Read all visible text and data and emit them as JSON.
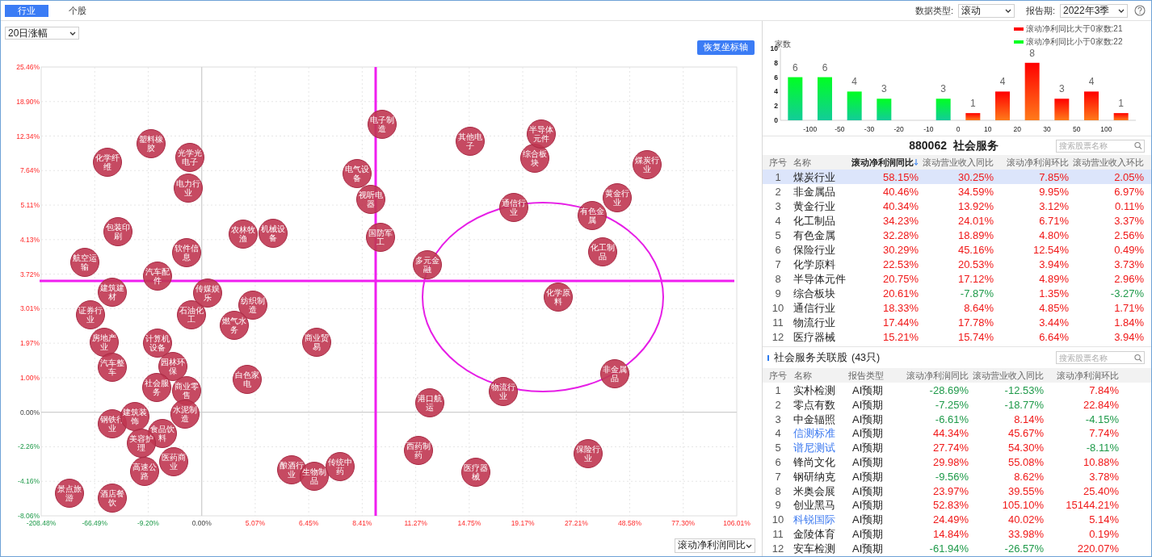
{
  "tabs": [
    {
      "label": "行业",
      "selected": true
    },
    {
      "label": "个股",
      "selected": false
    }
  ],
  "filters": [
    {
      "label": "数据类型:",
      "value": "滚动"
    },
    {
      "label": "报告期:",
      "value": "2022年3季"
    }
  ],
  "scatter_panel": {
    "period_select": "20日涨幅",
    "reset_button": "恢复坐标轴",
    "x_metric_select": "滚动净利润同比",
    "y_axis_labels": [
      "25.46%",
      "18.90%",
      "12.34%",
      "7.64%",
      "5.11%",
      "4.13%",
      "3.72%",
      "3.01%",
      "1.97%",
      "1.00%",
      "0.00%",
      "-2.26%",
      "-4.16%",
      "-8.06%"
    ],
    "x_axis_labels": [
      "-208.48%",
      "-66.49%",
      "-9.20%",
      "0.00%",
      "5.07%",
      "6.45%",
      "8.41%",
      "11.27%",
      "14.75%",
      "19.17%",
      "27.21%",
      "48.58%",
      "77.30%",
      "106.01%"
    ],
    "bubbles": [
      "化学纤维",
      "塑料橡胶",
      "光学光电子",
      "电力行业",
      "包装印刷",
      "航空运输",
      "软件信息",
      "汽车配件",
      "农林牧渔",
      "机械设备",
      "电子制造",
      "电气设备",
      "视听电器",
      "国防军工",
      "证券行业",
      "建筑建材",
      "石油化工",
      "传媒娱乐",
      "纺织制造",
      "燃气水务",
      "房地产业",
      "计算机设备",
      "商业贸易",
      "汽车整车",
      "园林环保",
      "社会服务",
      "商业零售",
      "白色家电",
      "钢铁行业",
      "建筑装饰",
      "食品饮料",
      "水泥制造",
      "美容护理",
      "医药商业",
      "高速公路",
      "景点旅游",
      "酒店餐饮",
      "酿酒行业",
      "生物制品",
      "传统中药",
      "其他电子",
      "综合板块",
      "半导体元件",
      "煤炭行业",
      "通信行业",
      "有色金属",
      "黄金行业",
      "化工制品",
      "多元金融",
      "化学原料",
      "非金属品",
      "物流行业",
      "港口航运",
      "西药制药",
      "医疗器械",
      "保险行业"
    ]
  },
  "distribution": {
    "chart_data": {
      "type": "bar",
      "ylabel": "家数",
      "categories": [
        null,
        null,
        null,
        null,
        null,
        null,
        null,
        null,
        null,
        null,
        null,
        null
      ],
      "yticks": [
        0,
        2,
        4,
        6,
        8,
        10
      ],
      "ylim": [
        0,
        10
      ],
      "data_labels": true,
      "legend": "top-right",
      "series": [
        {
          "name": "滚动净利同比大于0家数:21",
          "color": "#ff0000",
          "values": [
            null,
            null,
            null,
            null,
            null,
            null,
            1,
            4,
            8,
            3,
            4,
            1
          ]
        },
        {
          "name": "滚动净利同比小于0家数:22",
          "color": "#00ff22",
          "values": [
            6,
            6,
            4,
            3,
            null,
            3,
            null,
            null,
            null,
            null,
            null,
            null
          ]
        }
      ]
    },
    "bin_edge_labels": [
      "-100",
      "-50",
      "-30",
      "-20",
      "-10",
      "0",
      "10",
      "20",
      "30",
      "50",
      "100"
    ]
  },
  "industry_table": {
    "title": "880062  社会服务",
    "search_placeholder": "搜索股票名称",
    "columns": [
      {
        "label": "序号",
        "sorted": false
      },
      {
        "label": "名称",
        "sorted": false
      },
      {
        "label": "滚动净利润同比",
        "sorted": true
      },
      {
        "label": "滚动营业收入同比",
        "sorted": false
      },
      {
        "label": "滚动净利润环比",
        "sorted": false
      },
      {
        "label": "滚动营业收入环比",
        "sorted": false
      }
    ],
    "rows": [
      {
        "index": "1",
        "name": "煤炭行业",
        "values": [
          "58.15%",
          "30.25%",
          "7.85%",
          "2.05%"
        ],
        "selected": true
      },
      {
        "index": "2",
        "name": "非金属品",
        "values": [
          "40.46%",
          "34.59%",
          "9.95%",
          "6.97%"
        ],
        "selected": false
      },
      {
        "index": "3",
        "name": "黄金行业",
        "values": [
          "40.34%",
          "13.92%",
          "3.12%",
          "0.11%"
        ],
        "selected": false
      },
      {
        "index": "4",
        "name": "化工制品",
        "values": [
          "34.23%",
          "24.01%",
          "6.71%",
          "3.37%"
        ],
        "selected": false
      },
      {
        "index": "5",
        "name": "有色金属",
        "values": [
          "32.28%",
          "18.89%",
          "4.80%",
          "2.56%"
        ],
        "selected": false
      },
      {
        "index": "6",
        "name": "保险行业",
        "values": [
          "30.29%",
          "45.16%",
          "12.54%",
          "0.49%"
        ],
        "selected": false
      },
      {
        "index": "7",
        "name": "化学原料",
        "values": [
          "22.53%",
          "20.53%",
          "3.94%",
          "3.73%"
        ],
        "selected": false
      },
      {
        "index": "8",
        "name": "半导体元件",
        "values": [
          "20.75%",
          "17.12%",
          "4.89%",
          "2.96%"
        ],
        "selected": false
      },
      {
        "index": "9",
        "name": "综合板块",
        "values": [
          "20.61%",
          "-7.87%",
          "1.35%",
          "-3.27%"
        ],
        "selected": false
      },
      {
        "index": "10",
        "name": "通信行业",
        "values": [
          "18.33%",
          "8.64%",
          "4.85%",
          "1.71%"
        ],
        "selected": false
      },
      {
        "index": "11",
        "name": "物流行业",
        "values": [
          "17.44%",
          "17.78%",
          "3.44%",
          "1.84%"
        ],
        "selected": false
      },
      {
        "index": "12",
        "name": "医疗器械",
        "values": [
          "15.21%",
          "15.74%",
          "6.64%",
          "3.94%"
        ],
        "selected": false
      }
    ]
  },
  "related_table": {
    "title": "社会服务关联股",
    "count": "(43只)",
    "search_placeholder": "搜索股票名称",
    "columns": [
      "序号",
      "名称",
      "报告类型",
      "滚动净利润同比",
      "滚动营业收入同比",
      "滚动净利润环比"
    ],
    "rows": [
      {
        "index": "1",
        "name": "实朴检测",
        "linked": false,
        "type": "AI预期",
        "values": [
          "-28.69%",
          "-12.53%",
          "7.84%"
        ]
      },
      {
        "index": "2",
        "name": "零点有数",
        "linked": false,
        "type": "AI预期",
        "values": [
          "-7.25%",
          "-18.77%",
          "22.84%"
        ]
      },
      {
        "index": "3",
        "name": "中金辐照",
        "linked": false,
        "type": "AI预期",
        "values": [
          "-6.61%",
          "8.14%",
          "-4.15%"
        ]
      },
      {
        "index": "4",
        "name": "信测标准",
        "linked": true,
        "type": "AI预期",
        "values": [
          "44.34%",
          "45.67%",
          "7.74%"
        ]
      },
      {
        "index": "5",
        "name": "谱尼测试",
        "linked": true,
        "type": "AI预期",
        "values": [
          "27.74%",
          "54.30%",
          "-8.11%"
        ]
      },
      {
        "index": "6",
        "name": "锋尚文化",
        "linked": false,
        "type": "AI预期",
        "values": [
          "29.98%",
          "55.08%",
          "10.88%"
        ]
      },
      {
        "index": "7",
        "name": "钢研纳克",
        "linked": false,
        "type": "AI预期",
        "values": [
          "-9.56%",
          "8.62%",
          "3.78%"
        ]
      },
      {
        "index": "8",
        "name": "米奥会展",
        "linked": false,
        "type": "AI预期",
        "values": [
          "23.97%",
          "39.55%",
          "25.40%"
        ]
      },
      {
        "index": "9",
        "name": "创业黑马",
        "linked": false,
        "type": "AI预期",
        "values": [
          "52.83%",
          "105.10%",
          "15144.21%"
        ]
      },
      {
        "index": "10",
        "name": "科锐国际",
        "linked": true,
        "type": "AI预期",
        "values": [
          "24.49%",
          "40.02%",
          "5.14%"
        ]
      },
      {
        "index": "11",
        "name": "金陵体育",
        "linked": false,
        "type": "AI预期",
        "values": [
          "14.84%",
          "33.98%",
          "0.19%"
        ]
      },
      {
        "index": "12",
        "name": "安车检测",
        "linked": false,
        "type": "AI预期",
        "values": [
          "-61.94%",
          "-26.57%",
          "220.07%"
        ]
      }
    ]
  }
}
